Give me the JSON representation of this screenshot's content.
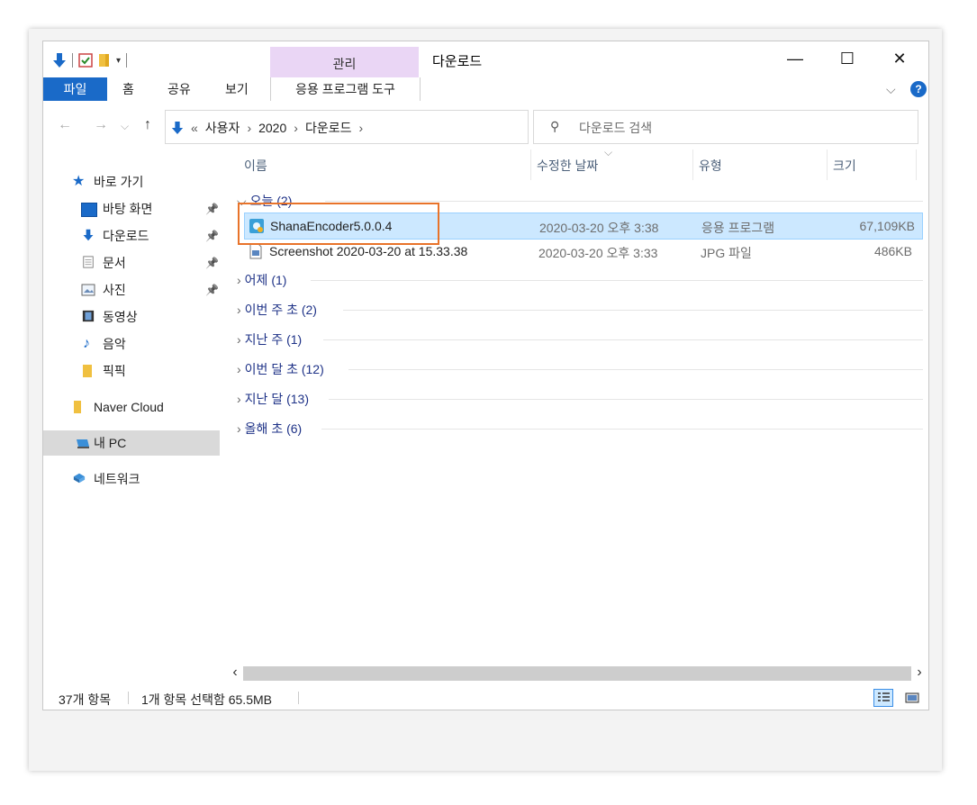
{
  "window": {
    "title": "다운로드",
    "context_tab": "관리",
    "controls": {
      "minimize": "—",
      "maximize": "☐",
      "close": "✕"
    }
  },
  "ribbon": {
    "file_tab": "파일",
    "tabs": [
      "홈",
      "공유",
      "보기"
    ],
    "context_tab": "응용 프로그램 도구",
    "expand": "⌵",
    "help": "?"
  },
  "address": {
    "prefix": "«",
    "crumbs": [
      "사용자",
      "2020",
      "다운로드"
    ],
    "separator": "›",
    "dropdown": "⌵",
    "refresh": "↻",
    "search_icon": "⚲",
    "search_placeholder": "다운로드 검색"
  },
  "nav": {
    "back": "←",
    "forward": "→",
    "recent": "⌵",
    "up": "↑",
    "quick_access": "바로 가기",
    "items": [
      {
        "label": "바탕 화면",
        "icon": "desktop-icon",
        "pinned": true
      },
      {
        "label": "다운로드",
        "icon": "download-icon",
        "pinned": true
      },
      {
        "label": "문서",
        "icon": "document-icon",
        "pinned": true
      },
      {
        "label": "사진",
        "icon": "pictures-icon",
        "pinned": true
      },
      {
        "label": "동영상",
        "icon": "video-icon",
        "pinned": false
      },
      {
        "label": "음악",
        "icon": "music-icon",
        "pinned": false
      },
      {
        "label": "픽픽",
        "icon": "folder-icon",
        "pinned": false
      }
    ],
    "cloud": "Naver Cloud",
    "pc": "내 PC",
    "network": "네트워크",
    "pin_glyph": "📌"
  },
  "columns": {
    "name": "이름",
    "date": "수정한 날짜",
    "type": "유형",
    "size": "크기",
    "sort_indicator": "⌵"
  },
  "groups": [
    {
      "label": "오늘 (2)",
      "expanded": true
    },
    {
      "label": "어제 (1)",
      "expanded": false
    },
    {
      "label": "이번 주 초 (2)",
      "expanded": false
    },
    {
      "label": "지난 주 (1)",
      "expanded": false
    },
    {
      "label": "이번 달 초 (12)",
      "expanded": false
    },
    {
      "label": "지난 달 (13)",
      "expanded": false
    },
    {
      "label": "올해 초 (6)",
      "expanded": false
    }
  ],
  "files": [
    {
      "name": "ShanaEncoder5.0.0.4",
      "date": "2020-03-20 오후 3:38",
      "type": "응용 프로그램",
      "size": "67,109KB",
      "selected": true
    },
    {
      "name": "Screenshot 2020-03-20 at 15.33.38",
      "date": "2020-03-20 오후 3:33",
      "type": "JPG 파일",
      "size": "486KB",
      "selected": false
    }
  ],
  "scroll": {
    "left": "‹",
    "right": "›"
  },
  "status": {
    "count": "37개 항목",
    "selection": "1개 항목 선택함 65.5MB"
  },
  "colors": {
    "accent": "#1a6ac8",
    "context_tab_bg": "#ead6f5",
    "selection_bg": "#cce8ff",
    "highlight_box": "#e8732a",
    "group_text": "#1e3287"
  }
}
